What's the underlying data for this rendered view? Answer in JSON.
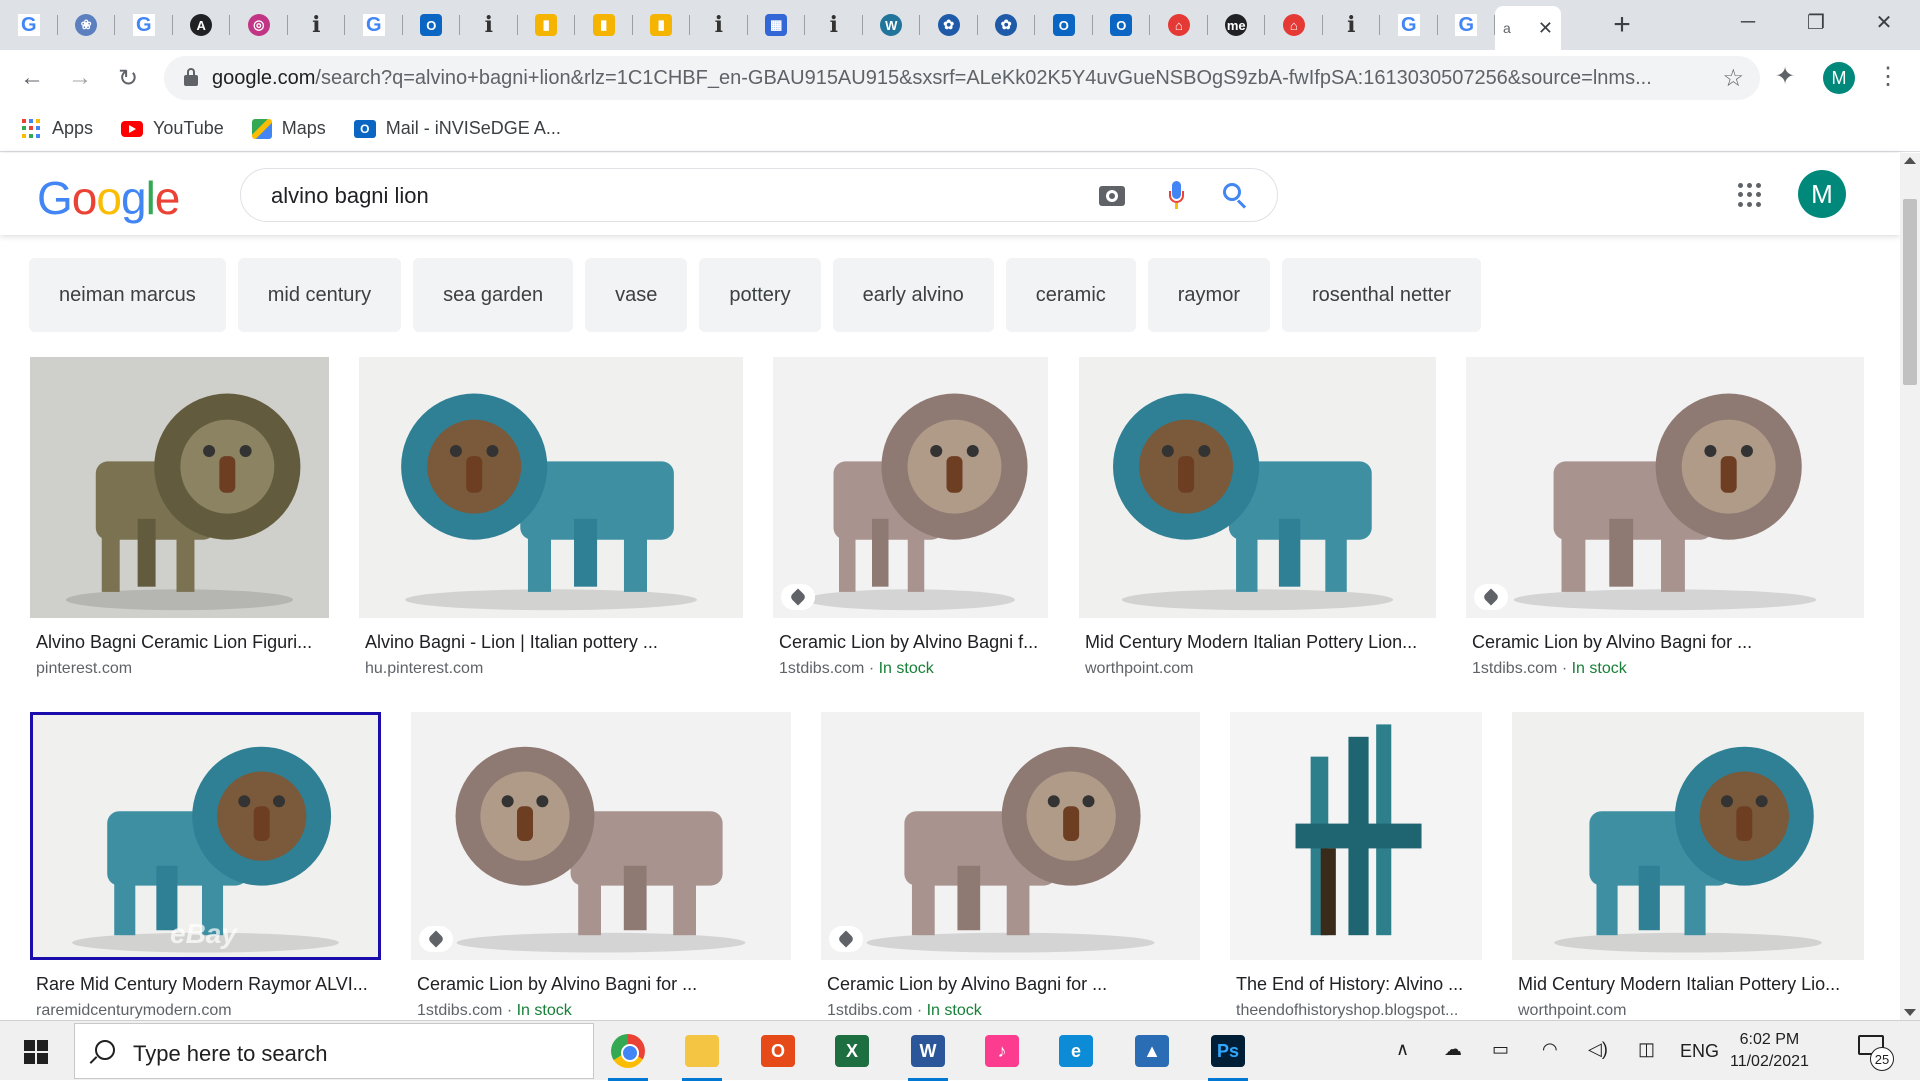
{
  "browser": {
    "tabs": [
      {
        "icon": "google-icon",
        "letter": "G"
      },
      {
        "icon": "bird-icon",
        "letter": "❀"
      },
      {
        "icon": "google-icon",
        "letter": "G"
      },
      {
        "icon": "circle-a-icon",
        "letter": "A"
      },
      {
        "icon": "instagram-icon",
        "letter": "◎"
      },
      {
        "icon": "info-icon",
        "letter": "i"
      },
      {
        "icon": "google-icon",
        "letter": "G"
      },
      {
        "icon": "outlook-icon",
        "letter": "O"
      },
      {
        "icon": "info-icon",
        "letter": "i"
      },
      {
        "icon": "shopping-bag-icon",
        "letter": "▮"
      },
      {
        "icon": "shopping-bag-icon",
        "letter": "▮"
      },
      {
        "icon": "shopping-bag-icon",
        "letter": "▮"
      },
      {
        "icon": "info-icon",
        "letter": "i"
      },
      {
        "icon": "calendar-icon",
        "letter": "▦"
      },
      {
        "icon": "info-icon",
        "letter": "i"
      },
      {
        "icon": "wordpress-icon",
        "letter": "W"
      },
      {
        "icon": "flower-icon",
        "letter": "✿"
      },
      {
        "icon": "flower-icon",
        "letter": "✿"
      },
      {
        "icon": "outlook-icon",
        "letter": "O"
      },
      {
        "icon": "outlook-icon",
        "letter": "O"
      },
      {
        "icon": "home-icon",
        "letter": "⌂"
      },
      {
        "icon": "me-icon",
        "letter": "me"
      },
      {
        "icon": "home-icon",
        "letter": "⌂"
      },
      {
        "icon": "info-icon",
        "letter": "i"
      },
      {
        "icon": "google-icon",
        "letter": "G"
      },
      {
        "icon": "google-icon",
        "letter": "G"
      }
    ],
    "active_tab": {
      "label": "a",
      "close": "✕"
    },
    "new_tab": "+",
    "window_controls": {
      "minimize": "─",
      "restore": "❐",
      "close": "✕"
    },
    "url": {
      "host": "google.com",
      "path": "/search?q=alvino+bagni+lion&rlz=1C1CHBF_en-GBAU915AU915&sxsrf=ALeKk02K5Y4uvGueNSBOgS9zbA-fwIfpSA:1613030507256&source=lnms..."
    },
    "profile_letter": "M",
    "bookmarks": [
      {
        "label": "Apps",
        "icon": "apps-grid-icon"
      },
      {
        "label": "YouTube",
        "icon": "youtube-icon"
      },
      {
        "label": "Maps",
        "icon": "maps-icon"
      },
      {
        "label": "Mail - iNVISeDGE A...",
        "icon": "outlook-mail-icon"
      }
    ]
  },
  "google": {
    "logo": "Google",
    "query": "alvino bagni lion",
    "avatar_letter": "M",
    "chips": [
      "neiman marcus",
      "mid century",
      "sea garden",
      "vase",
      "pottery",
      "early alvino",
      "ceramic",
      "raymor",
      "rosenthal netter"
    ],
    "results_row1": [
      {
        "title": "Alvino Bagni Ceramic Lion Figuri...",
        "source": "pinterest.com",
        "stock": "",
        "palette": "bronze"
      },
      {
        "title": "Alvino Bagni - Lion | Italian pottery ...",
        "source": "hu.pinterest.com",
        "stock": "",
        "palette": "turquoise"
      },
      {
        "title": "Ceramic Lion by Alvino Bagni f...",
        "source": "1stdibs.com · ",
        "stock": "In stock",
        "palette": "speckled"
      },
      {
        "title": "Mid Century Modern Italian Pottery Lion...",
        "source": "worthpoint.com",
        "stock": "",
        "palette": "turquoise"
      },
      {
        "title": "Ceramic Lion by Alvino Bagni for ...",
        "source": "1stdibs.com · ",
        "stock": "In stock",
        "palette": "speckled"
      }
    ],
    "results_row2": [
      {
        "title": "Rare Mid Century Modern Raymor ALVI...",
        "source": "raremidcenturymodern.com",
        "stock": "",
        "palette": "turquoise",
        "watermark": "eBay"
      },
      {
        "title": "Ceramic Lion by Alvino Bagni for ...",
        "source": "1stdibs.com · ",
        "stock": "In stock",
        "palette": "speckled"
      },
      {
        "title": "Ceramic Lion by Alvino Bagni for ...",
        "source": "1stdibs.com · ",
        "stock": "In stock",
        "palette": "speckled"
      },
      {
        "title": "The End of History: Alvino ...",
        "source": "theendofhistoryshop.blogspot...",
        "stock": "",
        "palette": "teal-figures"
      },
      {
        "title": "Mid Century Modern Italian Pottery Lio...",
        "source": "worthpoint.com",
        "stock": "",
        "palette": "turquoise"
      }
    ]
  },
  "taskbar": {
    "search_placeholder": "Type here to search",
    "apps": [
      {
        "name": "chrome",
        "label": ""
      },
      {
        "name": "file-explorer",
        "label": ""
      },
      {
        "name": "office",
        "label": "O"
      },
      {
        "name": "excel",
        "label": "X"
      },
      {
        "name": "word",
        "label": "W"
      },
      {
        "name": "itunes",
        "label": "♪"
      },
      {
        "name": "edge",
        "label": "e"
      },
      {
        "name": "photos",
        "label": "▲"
      },
      {
        "name": "photoshop",
        "label": "Ps"
      }
    ],
    "language": "ENG",
    "time": "6:02 PM",
    "date": "11/02/2021",
    "notifications": "25"
  },
  "colors": {
    "brand_blue": "#4285f4",
    "brand_red": "#ea4335",
    "brand_yellow": "#fbbc04",
    "brand_green": "#34a853",
    "stock_green": "#188038",
    "avatar_teal": "#00897b"
  }
}
